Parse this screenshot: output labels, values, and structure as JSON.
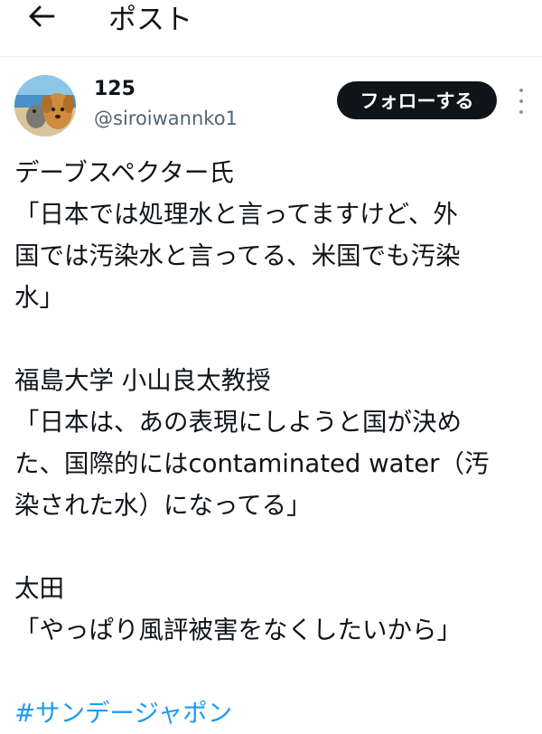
{
  "header": {
    "title": "ポスト"
  },
  "author": {
    "name": "125",
    "handle": "@siroiwannko1"
  },
  "actions": {
    "follow_label": "フォローする"
  },
  "post": {
    "p1": [
      "デーブスペクター氏",
      "「日本では処理水と言ってますけど、外",
      "国では汚染水と言ってる、米国でも汚染",
      "水」"
    ],
    "p2": [
      "福島大学 小山良太教授",
      "「日本は、あの表現にしようと国が決め",
      "た、国際的にはcontaminated water（汚",
      "染された水）になってる」"
    ],
    "p3": [
      "太田",
      "「やっぱり風評被害をなくしたいから」"
    ],
    "hashtag": "#サンデージャポン"
  },
  "colors": {
    "accent": "#1d9bf0",
    "button_bg": "#0f1419",
    "secondary_text": "#536471"
  },
  "icons": {
    "back": "arrow-left-icon",
    "more": "more-vertical-icon"
  }
}
